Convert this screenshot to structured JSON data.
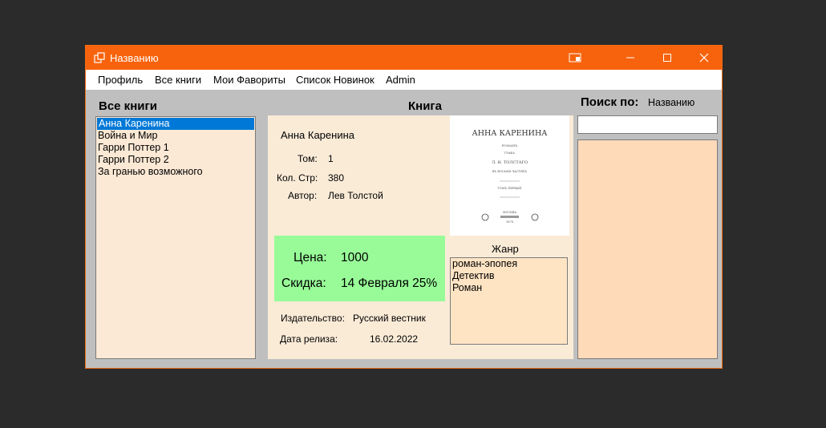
{
  "window": {
    "title": "Названию"
  },
  "menu": [
    "Профиль",
    "Все книги",
    "Мои Фавориты",
    "Список Новинок",
    "Admin"
  ],
  "all_books": {
    "title": "Все книги",
    "items": [
      "Анна Каренина",
      "Война и Мир",
      "Гарри Поттер 1",
      "Гарри Поттер 2",
      "За гранью возможного"
    ],
    "selected_index": 0
  },
  "book": {
    "section_title": "Книга",
    "name": "Анна Каренина",
    "volume_label": "Том:",
    "volume": "1",
    "pages_label": "Кол. Стр:",
    "pages": "380",
    "author_label": "Автор:",
    "author": "Лев Толстой",
    "price_label": "Цена:",
    "price": "1000",
    "discount_label": "Скидка:",
    "discount": "14 Февраля 25%",
    "publisher_label": "Издательство:",
    "publisher": "Русский вестник",
    "release_label": "Дата релиза:",
    "release_date": "16.02.2022",
    "cover": {
      "title": "АННА КАРЕНИНА",
      "lines": [
        "РОМАНЪ",
        "ГРАФА",
        "Л. Н. ТОЛСТАГО",
        "ВЪ ВОСЬМИ ЧАСТЯХЪ",
        "ТОМЪ ПЕРВЫЙ",
        "МОСКВА",
        "1878"
      ]
    },
    "genre_label": "Жанр",
    "genres": [
      "роман-эпопея",
      "Детектив",
      "Роман"
    ]
  },
  "search": {
    "label": "Поиск по:",
    "mode": "Названию",
    "value": ""
  }
}
